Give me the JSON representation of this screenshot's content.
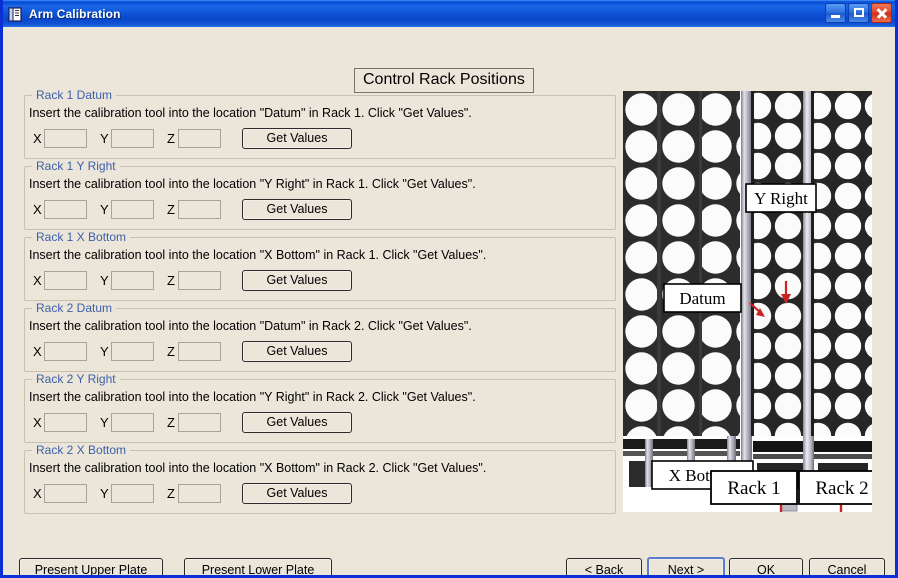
{
  "window": {
    "title": "Arm Calibration",
    "icon": "app-window-icon",
    "controls": {
      "minimize": "minimize-icon",
      "maximize": "maximize-icon",
      "close": "close-icon"
    },
    "accent_titlebar": "#0b4fd6",
    "background": "#ece6da",
    "border": "#0a2fd4"
  },
  "header": {
    "title": "Control Rack Positions"
  },
  "axis_labels": {
    "x": "X",
    "y": "Y",
    "z": "Z"
  },
  "get_values_label": "Get Values",
  "groups": [
    {
      "legend": "Rack 1 Datum",
      "description": "Insert the calibration tool into the location \"Datum\" in Rack 1.  Click \"Get Values\".",
      "x_value": "",
      "y_value": "",
      "z_value": "",
      "button": "Get Values"
    },
    {
      "legend": "Rack 1 Y Right",
      "description": "Insert the calibration tool into the location \"Y Right\" in Rack 1.  Click \"Get Values\".",
      "x_value": "",
      "y_value": "",
      "z_value": "",
      "button": "Get Values"
    },
    {
      "legend": "Rack 1 X Bottom",
      "description": "Insert the calibration tool into the location \"X Bottom\" in Rack 1.  Click \"Get Values\".",
      "x_value": "",
      "y_value": "",
      "z_value": "",
      "button": "Get Values"
    },
    {
      "legend": "Rack 2 Datum",
      "description": "Insert the calibration tool into the location \"Datum\" in Rack 2.  Click \"Get Values\".",
      "x_value": "",
      "y_value": "",
      "z_value": "",
      "button": "Get Values"
    },
    {
      "legend": "Rack 2 Y Right",
      "description": "Insert the calibration tool into the location \"Y Right\" in Rack 2.  Click \"Get Values\".",
      "x_value": "",
      "y_value": "",
      "z_value": "",
      "button": "Get Values"
    },
    {
      "legend": "Rack 2 X Bottom",
      "description": "Insert the calibration tool into the location \"X Bottom\" in Rack 2.  Click \"Get Values\".",
      "x_value": "",
      "y_value": "",
      "z_value": "",
      "button": "Get Values"
    }
  ],
  "diagram": {
    "alt": "Photograph of two sample racks viewed from above with callout labels",
    "callouts": [
      {
        "label": "Datum",
        "arrow_color": "#cc2222"
      },
      {
        "label": "Y Right",
        "arrow_color": "#cc2222"
      },
      {
        "label": "X Bottom",
        "arrow_color": "#cc2222"
      },
      {
        "label": "Rack 1",
        "arrow_color": "#cc2222"
      },
      {
        "label": "Rack 2",
        "arrow_color": "#cc2222"
      }
    ]
  },
  "footer": {
    "present_upper_plate": "Present Upper Plate",
    "present_lower_plate": "Present Lower Plate",
    "back": "< Back",
    "next": "Next >",
    "ok": "OK",
    "cancel": "Cancel"
  }
}
